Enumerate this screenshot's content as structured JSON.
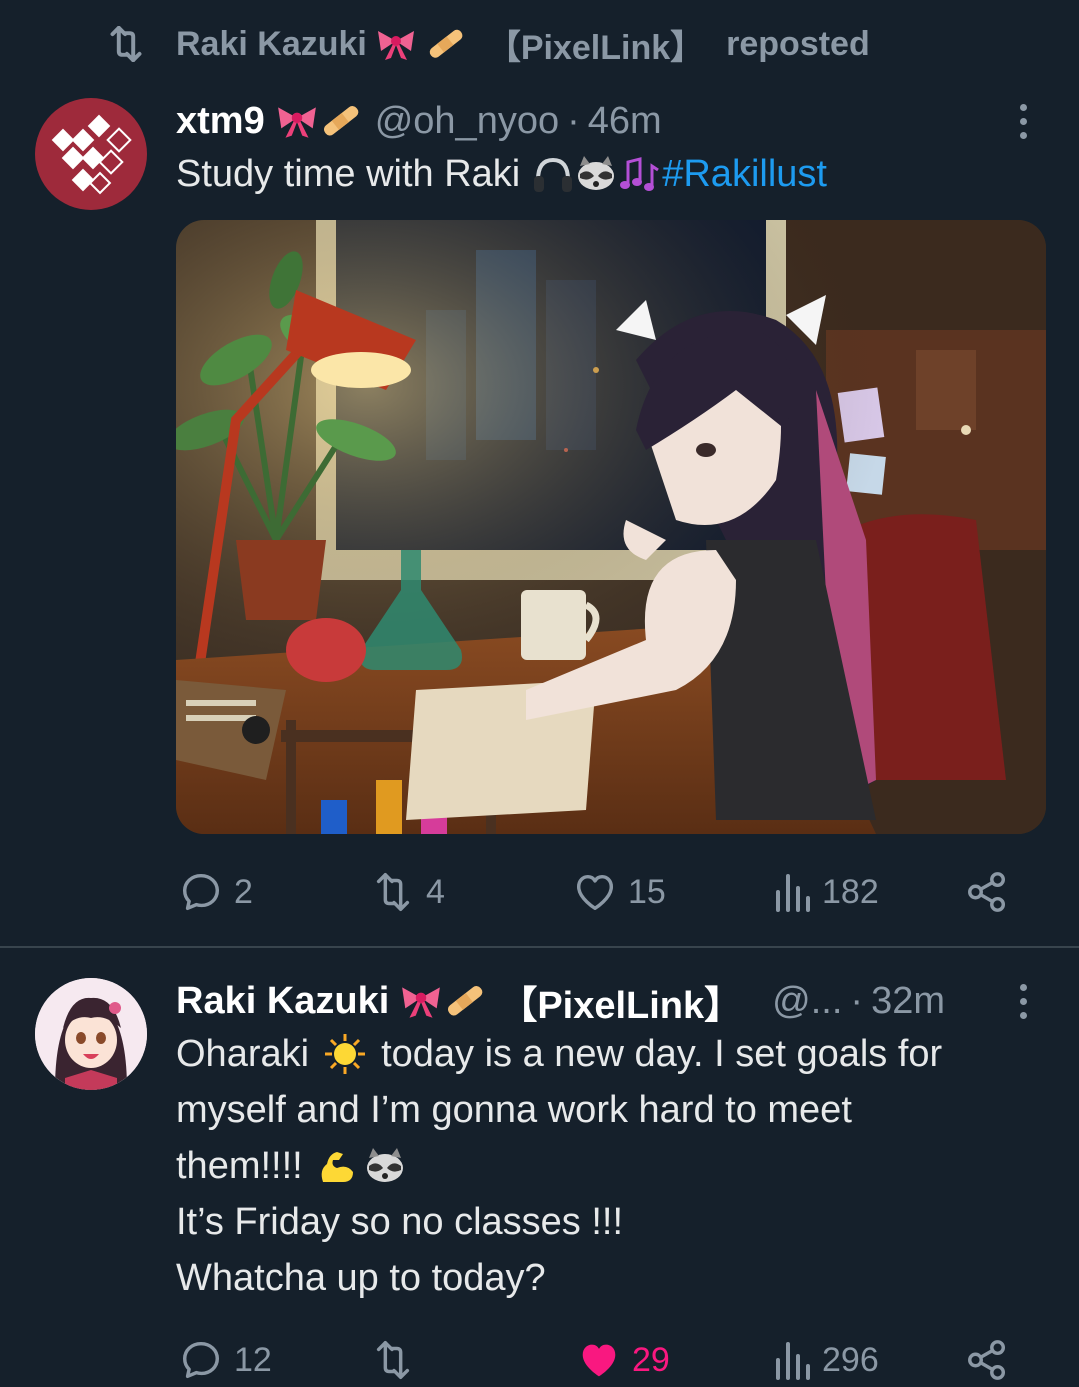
{
  "repost": {
    "name": "Raki Kazuki",
    "tag": "【PixelLink】",
    "suffix": "reposted"
  },
  "tweet1": {
    "display_name": "xtm9",
    "handle": "@oh_nyoo",
    "time": "46m",
    "text": "Study time with Raki",
    "hashtag": "#Rakillust",
    "image_alt": "Anime girl studying at a desk with a lamp, plant and flasks by a window at night",
    "actions": {
      "replies": "2",
      "reposts": "4",
      "likes": "15",
      "views": "182"
    },
    "avatar_color": "#9e2a3b"
  },
  "tweet2": {
    "display_name": "Raki Kazuki",
    "tag": "【PixelLink】",
    "handle": "@...",
    "time": "32m",
    "lines": [
      "Oharaki",
      "today is a new day. I set goals for",
      "myself and I’m gonna work hard to meet",
      "them!!!!",
      "It’s Friday so no classes !!!",
      "Whatcha up to today?"
    ],
    "actions": {
      "replies": "12",
      "reposts": "",
      "likes": "29",
      "views": "296"
    }
  },
  "colors": {
    "background": "#15202b",
    "muted": "#8b98a5",
    "link": "#1d9bf0",
    "like": "#f91880"
  },
  "icons": [
    "repost-icon",
    "bow-emoji",
    "bandage-emoji",
    "more-icon",
    "headphones-emoji",
    "raccoon-emoji",
    "music-notes-emoji",
    "reply-icon",
    "heart-icon",
    "views-icon",
    "share-icon",
    "sun-emoji",
    "flexed-biceps-emoji"
  ]
}
